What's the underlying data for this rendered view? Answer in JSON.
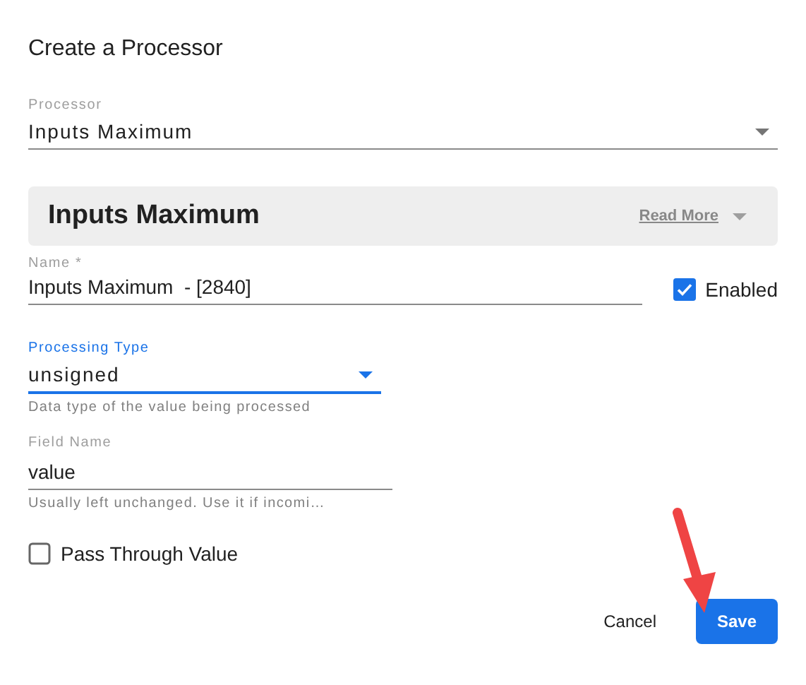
{
  "dialog": {
    "title": "Create a Processor"
  },
  "processor": {
    "label": "Processor",
    "value": "Inputs Maximum"
  },
  "info_panel": {
    "title": "Inputs Maximum",
    "link": "Read More",
    "expanded": false
  },
  "name_field": {
    "label": "Name *",
    "value": "Inputs Maximum  - [2840]"
  },
  "enabled": {
    "label": "Enabled",
    "checked": true
  },
  "processing_type": {
    "label": "Processing Type",
    "value": "unsigned",
    "helper": "Data type of the value being processed",
    "focused": true
  },
  "field_name": {
    "label": "Field Name",
    "value": "value",
    "helper": "Usually left unchanged. Use it if incomi…",
    "focused": false
  },
  "pass_through": {
    "label": "Pass Through Value",
    "checked": false
  },
  "buttons": [
    {
      "label": "Cancel",
      "kind": "text"
    },
    {
      "label": "Save",
      "kind": "primary"
    }
  ]
}
